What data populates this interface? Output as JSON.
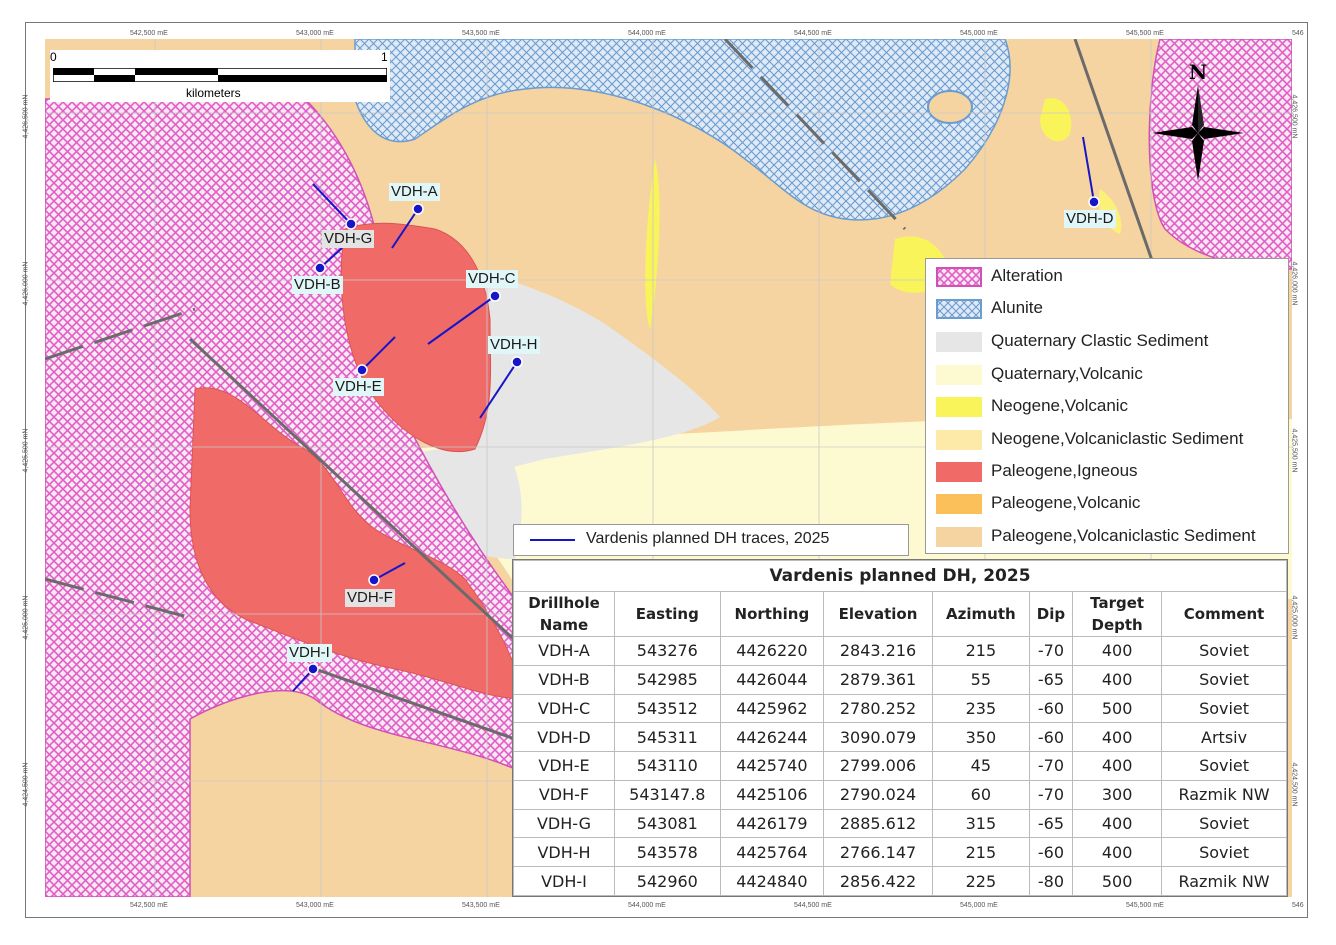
{
  "scale_bar": {
    "start": "0",
    "end": "1",
    "unit": "kilometers"
  },
  "north_arrow": {
    "label": "N",
    "icon": "north-arrow-icon"
  },
  "grid": {
    "x_ticks": [
      "542,500 mE",
      "543,000 mE",
      "543,500 mE",
      "544,000 mE",
      "544,500 mE",
      "545,000 mE",
      "545,500 mE",
      "546"
    ],
    "y_ticks": [
      "4,426,500 mN",
      "4,426,000 mN",
      "4,425,500 mN",
      "4,425,000 mN",
      "4,424,500 mN"
    ]
  },
  "legend": {
    "items": [
      {
        "label": "Alteration",
        "color": "#e060c8",
        "pattern": "crosshatch"
      },
      {
        "label": "Alunite",
        "color": "#6a9cd0",
        "pattern": "crosshatch"
      },
      {
        "label": "Quaternary Clastic Sediment",
        "color": "#e6e6e6"
      },
      {
        "label": "Quaternary,Volcanic",
        "color": "#fdfad2"
      },
      {
        "label": "Neogene,Volcanic",
        "color": "#f8f45a"
      },
      {
        "label": "Neogene,Volcaniclastic Sediment",
        "color": "#fde9a8"
      },
      {
        "label": "Paleogene,Igneous",
        "color": "#f06b68"
      },
      {
        "label": "Paleogene,Volcanic",
        "color": "#fbc05a"
      },
      {
        "label": "Paleogene,Volcaniclastic Sediment",
        "color": "#f6d4a2"
      }
    ]
  },
  "trace_legend": {
    "label": "Vardenis planned DH traces, 2025",
    "color": "#1616c8"
  },
  "drillholes": [
    {
      "name": "VDH-A"
    },
    {
      "name": "VDH-B"
    },
    {
      "name": "VDH-C"
    },
    {
      "name": "VDH-D"
    },
    {
      "name": "VDH-E"
    },
    {
      "name": "VDH-F"
    },
    {
      "name": "VDH-G"
    },
    {
      "name": "VDH-H"
    },
    {
      "name": "VDH-I"
    }
  ],
  "table": {
    "title": "Vardenis planned DH, 2025",
    "headers": [
      "Drillhole Name",
      "Easting",
      "Northing",
      "Elevation",
      "Azimuth",
      "Dip",
      "Target Depth",
      "Comment"
    ],
    "rows": [
      [
        "VDH-A",
        "543276",
        "4426220",
        "2843.216",
        "215",
        "-70",
        "400",
        "Soviet"
      ],
      [
        "VDH-B",
        "542985",
        "4426044",
        "2879.361",
        "55",
        "-65",
        "400",
        "Soviet"
      ],
      [
        "VDH-C",
        "543512",
        "4425962",
        "2780.252",
        "235",
        "-60",
        "500",
        "Soviet"
      ],
      [
        "VDH-D",
        "545311",
        "4426244",
        "3090.079",
        "350",
        "-60",
        "400",
        "Artsiv"
      ],
      [
        "VDH-E",
        "543110",
        "4425740",
        "2799.006",
        "45",
        "-70",
        "400",
        "Soviet"
      ],
      [
        "VDH-F",
        "543147.8",
        "4425106",
        "2790.024",
        "60",
        "-70",
        "300",
        "Razmik NW"
      ],
      [
        "VDH-G",
        "543081",
        "4426179",
        "2885.612",
        "315",
        "-65",
        "400",
        "Soviet"
      ],
      [
        "VDH-H",
        "543578",
        "4425764",
        "2766.147",
        "215",
        "-60",
        "400",
        "Soviet"
      ],
      [
        "VDH-I",
        "542960",
        "4424840",
        "2856.422",
        "225",
        "-80",
        "500",
        "Razmik NW"
      ]
    ]
  }
}
